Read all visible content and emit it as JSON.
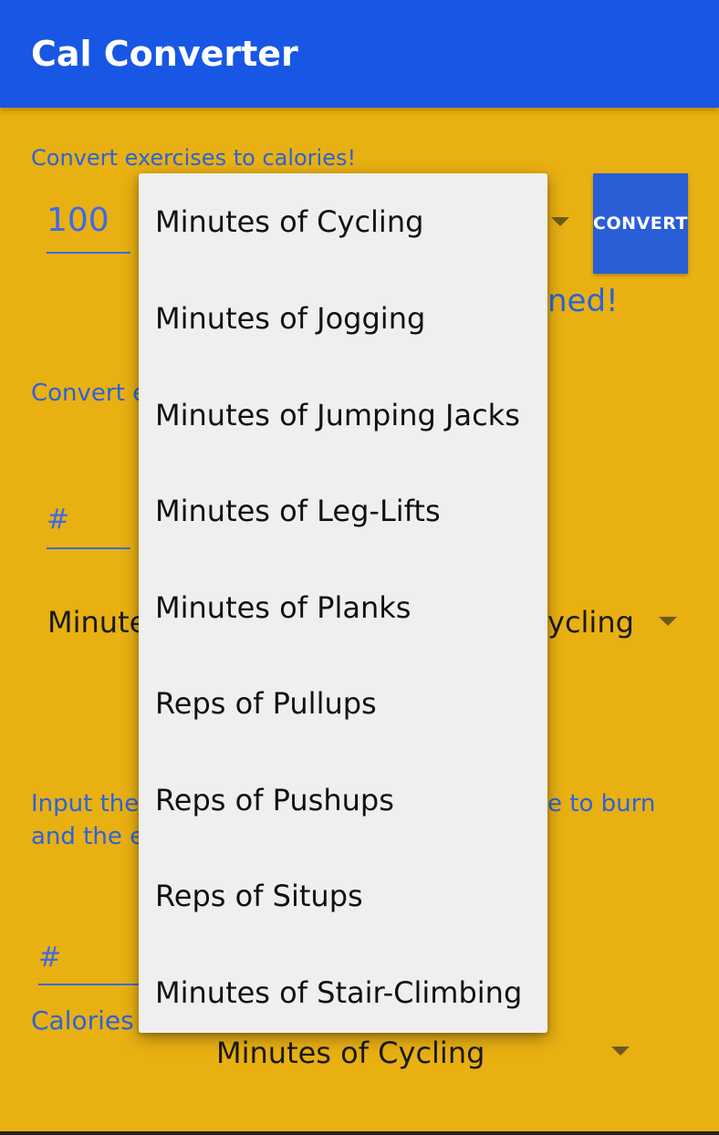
{
  "app": {
    "title": "Cal Converter"
  },
  "section1": {
    "heading": "Convert exercises to calories!",
    "amount_value": "100",
    "convert_label": "CONVERT",
    "result_fragment": "ned!"
  },
  "section2": {
    "heading_fragment": "Convert e",
    "amount_placeholder": "#",
    "from_fragment": "Minute",
    "to_fragment": "ycling"
  },
  "section3": {
    "line1_left": "Input the",
    "line1_right": "e to burn",
    "line2_left": "and the e",
    "amount_placeholder": "#",
    "calories_fragment": "Calories",
    "selected_exercise": "Minutes of Cycling"
  },
  "dropdown": {
    "options": [
      "Minutes of Cycling",
      "Minutes of Jogging",
      "Minutes of Jumping Jacks",
      "Minutes of Leg-Lifts",
      "Minutes of Planks",
      "Reps of Pullups",
      "Reps of Pushups",
      "Reps of Situps",
      "Minutes of Stair-Climbing"
    ]
  },
  "colors": {
    "appbar": "#1757e4",
    "background": "#e9b012",
    "accent_text": "#2b63d9",
    "button": "#2a5ed6",
    "popup": "#efefef"
  },
  "icons": {
    "spinner_arrow": "caret-down-icon"
  }
}
